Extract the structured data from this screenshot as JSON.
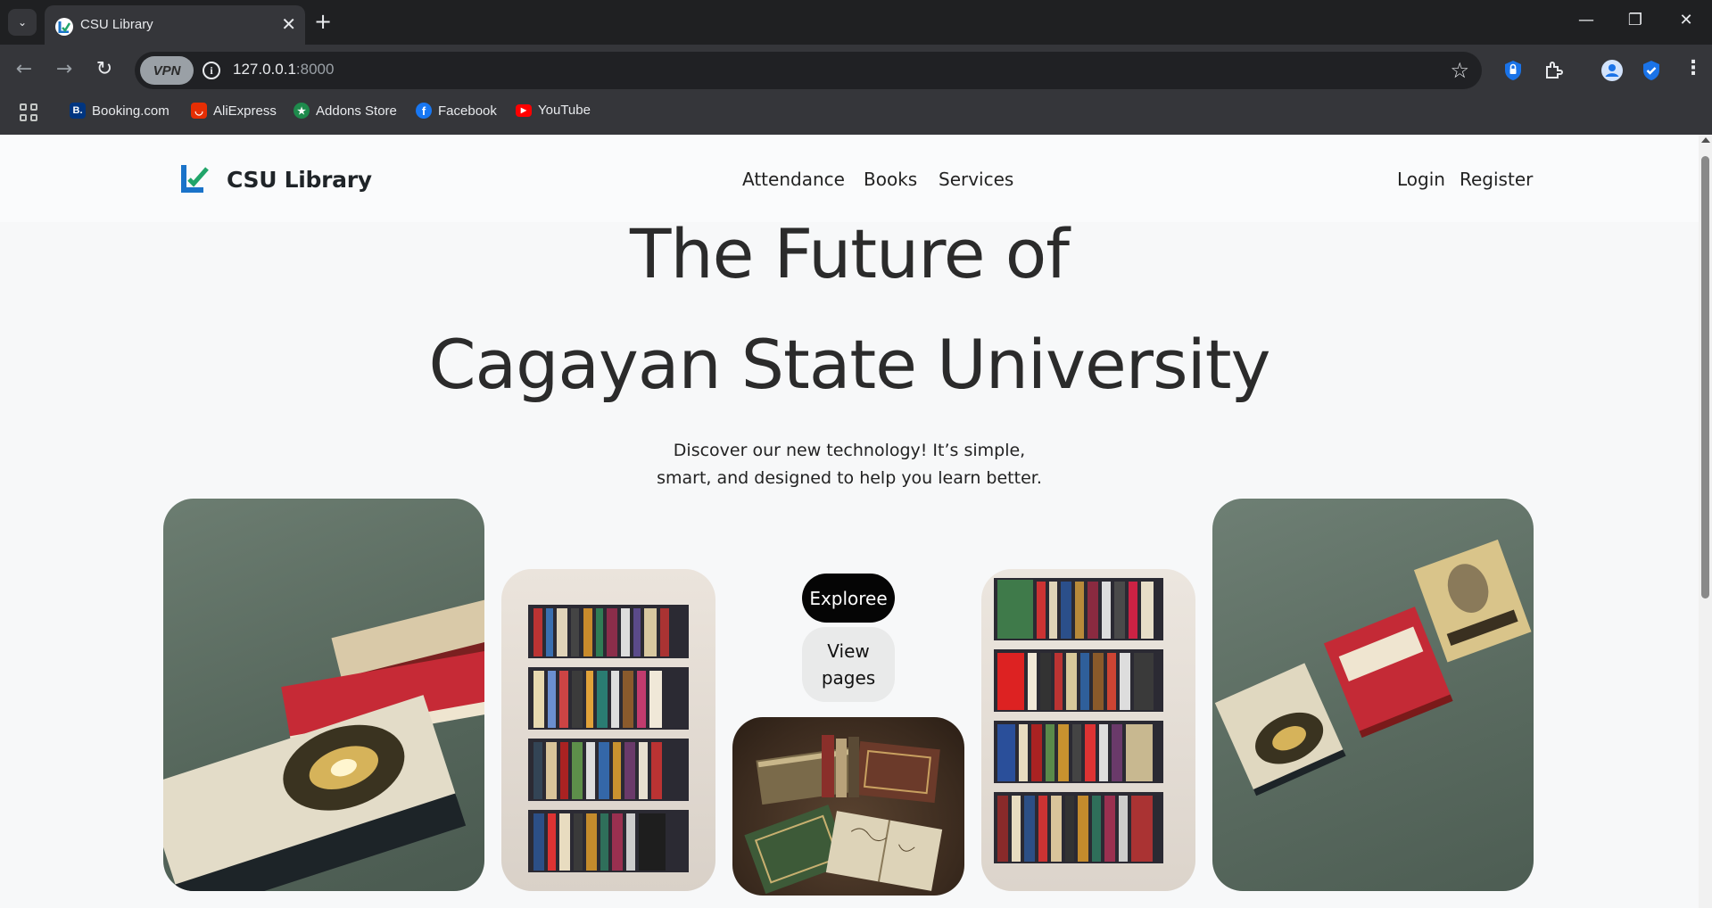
{
  "browser": {
    "tab_title": "CSU Library",
    "tab_close": "✕",
    "new_tab": "+",
    "url_host": "127.0.0.1",
    "url_port": ":8000",
    "vpn_label": "VPN",
    "bookmarks": [
      {
        "label": "Booking.com",
        "icon": "booking-icon",
        "color": "#003580",
        "glyph": "B."
      },
      {
        "label": "AliExpress",
        "icon": "aliexpress-icon",
        "color": "#e62e04",
        "glyph": "◡"
      },
      {
        "label": "Addons Store",
        "icon": "addons-store-icon",
        "color": "#1e8a4c",
        "glyph": "★"
      },
      {
        "label": "Facebook",
        "icon": "facebook-icon",
        "color": "#1877f2",
        "glyph": "f"
      },
      {
        "label": "YouTube",
        "icon": "youtube-icon",
        "color": "#ff0000",
        "glyph": "▶"
      }
    ]
  },
  "site": {
    "brand": "CSU Library",
    "nav": {
      "attendance": "Attendance",
      "books": "Books",
      "services": "Services",
      "login": "Login",
      "register": "Register"
    },
    "hero": {
      "line1": "The Future of",
      "line2": "Cagayan State University",
      "sub1": "Discover our new technology! It’s simple,",
      "sub2": "smart, and designed to help you learn better."
    },
    "buttons": {
      "explore": "Exploree",
      "view_pages": "View pages"
    },
    "colors": {
      "logo_blue": "#1a73c9",
      "logo_green": "#21a56a",
      "explore_bg": "#050505",
      "view_bg": "#e9eaea"
    }
  }
}
